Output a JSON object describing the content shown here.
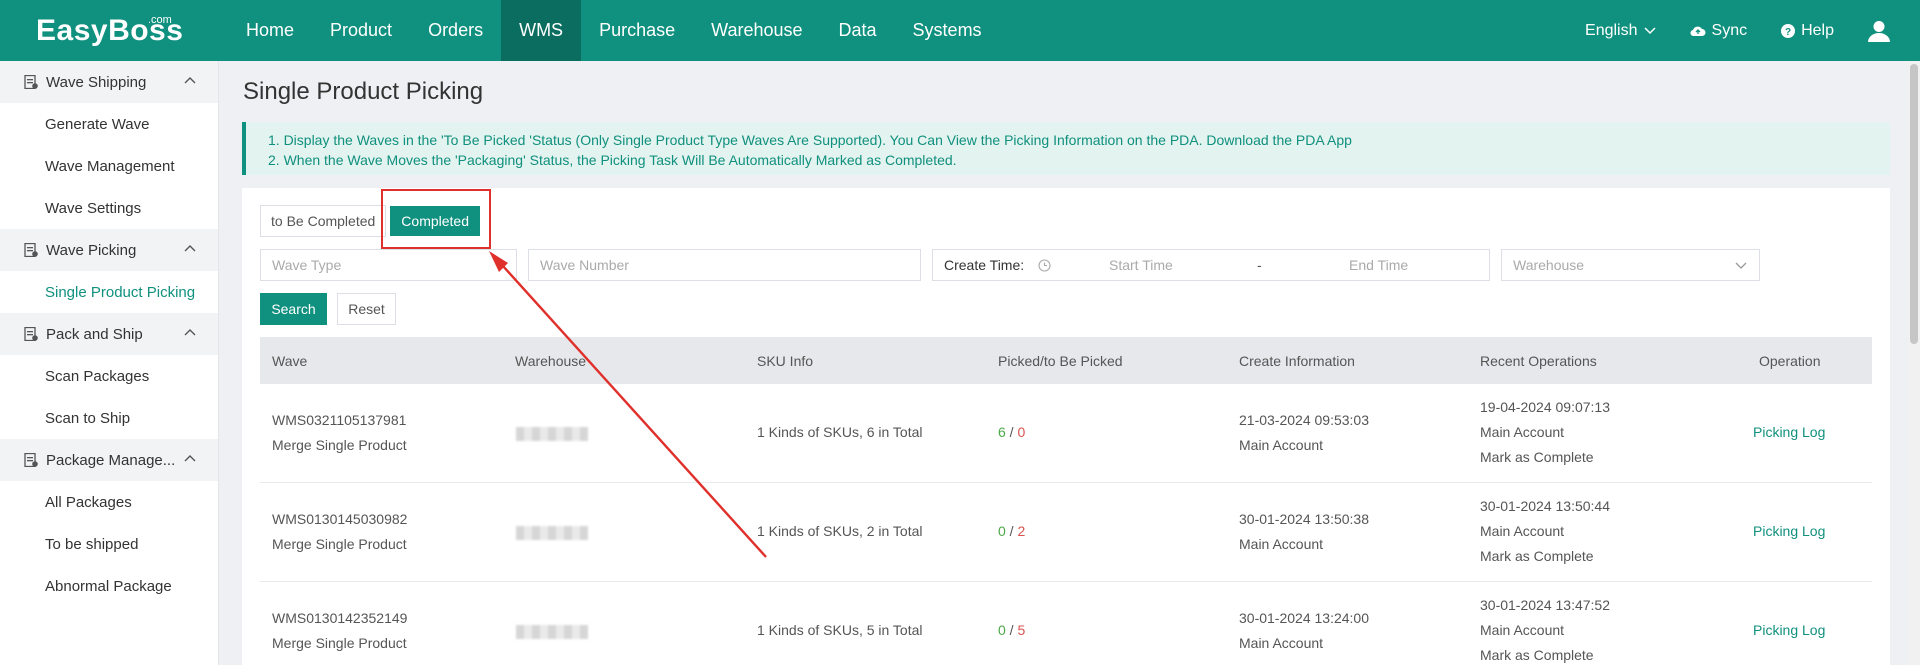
{
  "brand": {
    "name": "EasyBoss",
    "sup": ".com"
  },
  "nav": {
    "items": [
      "Home",
      "Product",
      "Orders",
      "WMS",
      "Purchase",
      "Warehouse",
      "Data",
      "Systems"
    ],
    "language": "English",
    "sync": "Sync",
    "help": "Help"
  },
  "sidebar": {
    "groups": [
      {
        "label": "Wave Shipping",
        "items": [
          "Generate Wave",
          "Wave Management",
          "Wave Settings"
        ]
      },
      {
        "label": "Wave Picking",
        "items": [
          "Single Product Picking"
        ]
      },
      {
        "label": "Pack and Ship",
        "items": [
          "Scan Packages",
          "Scan to Ship"
        ]
      },
      {
        "label": "Package Manage...",
        "items": [
          "All Packages",
          "To be shipped",
          "Abnormal Package"
        ]
      }
    ]
  },
  "page": {
    "title": "Single Product Picking",
    "notice_line1": "1. Display the Waves in the 'To Be Picked 'Status (Only Single Product Type Waves Are Supported). You Can View the Picking Information on the PDA. Download the PDA App",
    "notice_line2": "2. When the Wave Moves the 'Packaging' Status, the Picking Task Will Be Automatically Marked as Completed."
  },
  "tabs": {
    "tab1": "to Be Completed",
    "tab2": "Completed"
  },
  "filters": {
    "wave_type_placeholder": "Wave Type",
    "wave_number_placeholder": "Wave Number",
    "create_time_label": "Create Time:",
    "start_time_placeholder": "Start Time",
    "dash": "-",
    "end_time_placeholder": "End Time",
    "warehouse_placeholder": "Warehouse"
  },
  "buttons": {
    "search": "Search",
    "reset": "Reset"
  },
  "table": {
    "headers": [
      "Wave",
      "Warehouse",
      "SKU Info",
      "Picked/to Be Picked",
      "Create Information",
      "Recent Operations",
      "Operation"
    ],
    "rows": [
      {
        "wave": "WMS0321105137981",
        "type": "Merge Single Product",
        "sku": "1 Kinds of SKUs, 6 in Total",
        "picked": "6",
        "slash": " / ",
        "to_pick": "0",
        "create_time": "21-03-2024 09:53:03",
        "create_by": "Main Account",
        "op_time": "19-04-2024 09:07:13",
        "op_by": "Main Account",
        "op_action": "Mark as Complete",
        "link": "Picking Log"
      },
      {
        "wave": "WMS0130145030982",
        "type": "Merge Single Product",
        "sku": "1 Kinds of SKUs, 2 in Total",
        "picked": "0",
        "slash": " / ",
        "to_pick": "2",
        "create_time": "30-01-2024 13:50:38",
        "create_by": "Main Account",
        "op_time": "30-01-2024 13:50:44",
        "op_by": "Main Account",
        "op_action": "Mark as Complete",
        "link": "Picking Log"
      },
      {
        "wave": "WMS0130142352149",
        "type": "Merge Single Product",
        "sku": "1 Kinds of SKUs, 5 in Total",
        "picked": "0",
        "slash": " / ",
        "to_pick": "5",
        "create_time": "30-01-2024 13:24:00",
        "create_by": "Main Account",
        "op_time": "30-01-2024 13:47:52",
        "op_by": "Main Account",
        "op_action": "Mark as Complete",
        "link": "Picking Log"
      }
    ]
  },
  "colors": {
    "brand": "#10907e",
    "annotation": "#e0302b"
  }
}
